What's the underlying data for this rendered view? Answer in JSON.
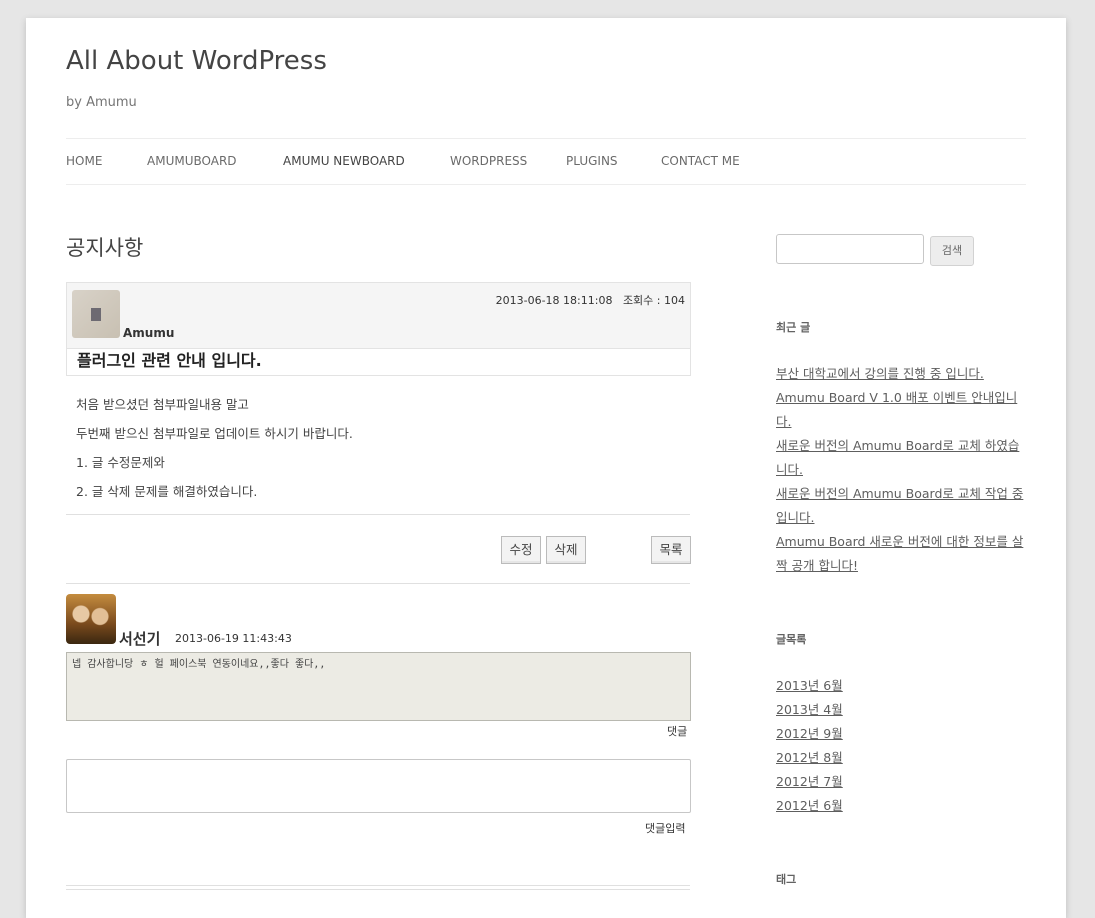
{
  "site": {
    "title": "All About WordPress",
    "description": "by Amumu"
  },
  "nav": [
    {
      "label": "HOME"
    },
    {
      "label": "AMUMUBOARD"
    },
    {
      "label": "AMUMU NEWBOARD"
    },
    {
      "label": "WORDPRESS"
    },
    {
      "label": "PLUGINS"
    },
    {
      "label": "CONTACT ME"
    }
  ],
  "page": {
    "title": "공지사항"
  },
  "post": {
    "meta": "2013-06-18 18:11:08   조회수 : 104",
    "author": "Amumu",
    "subject": "플러그인 관련 안내 입니다.",
    "body": [
      "처음 받으셨던 첨부파일내용 말고",
      "두번째 받으신 첨부파일로 업데이트 하시기 바랍니다.",
      "1. 글 수정문제와",
      "2. 글 삭제 문제를 해결하였습니다."
    ],
    "buttons": {
      "edit": "수정",
      "delete": "삭제",
      "list": "목록"
    }
  },
  "comment": {
    "author": "서선기",
    "date": "2013-06-19 11:43:43",
    "text": "넵 감사합니당 ㅎ 헐 페이스북 연동이네요,,좋다 좋다,,",
    "reply_label": "댓글",
    "submit_label": "댓글입력"
  },
  "sidebar": {
    "search_button": "검색",
    "recent_title": "최근 글",
    "recent_posts": [
      {
        "label": "부산 대학교에서 강의를 진행 중 입니다."
      },
      {
        "label": "Amumu Board V 1.0 배포 이벤트 안내입니다."
      },
      {
        "label": "새로운 버전의 Amumu Board로 교체 하였습니다."
      },
      {
        "label": "새로운 버전의 Amumu Board로 교체 작업 중 입니다."
      },
      {
        "label": "Amumu Board 새로운 버전에 대한 정보를 살짝 공개 합니다!"
      }
    ],
    "archive_title": "글목록",
    "archives": [
      {
        "label": "2013년 6월"
      },
      {
        "label": "2013년 4월"
      },
      {
        "label": "2012년 9월"
      },
      {
        "label": "2012년 8월"
      },
      {
        "label": "2012년 7월"
      },
      {
        "label": "2012년 6월"
      }
    ],
    "tags_title": "태그"
  }
}
